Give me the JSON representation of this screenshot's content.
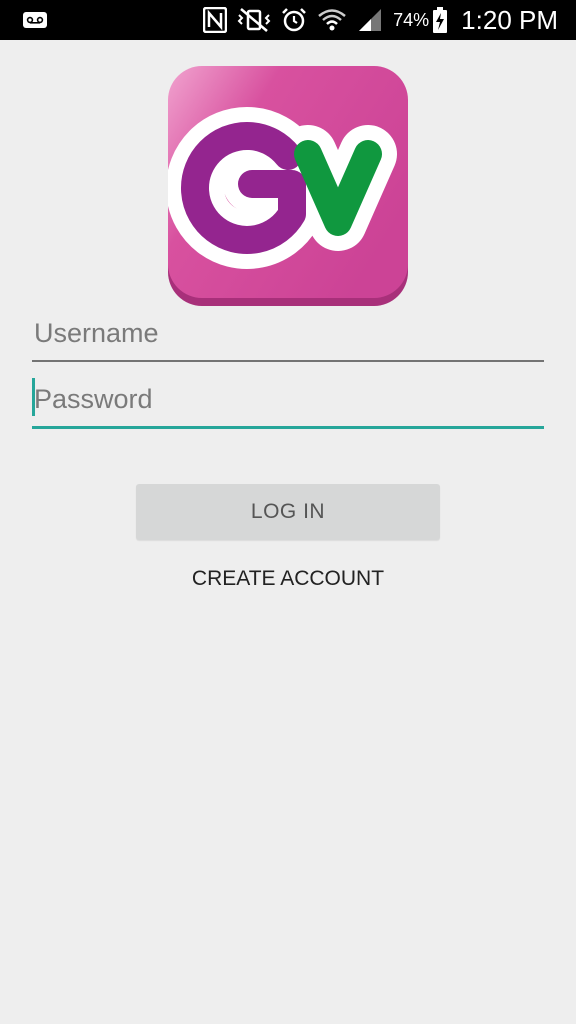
{
  "status_bar": {
    "left_icons": [
      "voicemail-icon"
    ],
    "right_icons": [
      "nfc-icon",
      "vibrate-mute-icon",
      "alarm-icon",
      "wifi-icon",
      "cell-signal-icon",
      "battery-charging-icon"
    ],
    "battery": "74%",
    "time": "1:20 PM"
  },
  "logo": {
    "text": "GV",
    "colors": {
      "background": "#d0479b",
      "g": "#94258f",
      "v": "#10983f"
    }
  },
  "login_form": {
    "username_placeholder": "Username",
    "password_placeholder": "Password",
    "login_label": "LOG IN",
    "create_account_label": "CREATE ACCOUNT"
  },
  "colors": {
    "accent": "#26a69a",
    "background": "#eeeeee",
    "button": "#d6d7d7"
  }
}
